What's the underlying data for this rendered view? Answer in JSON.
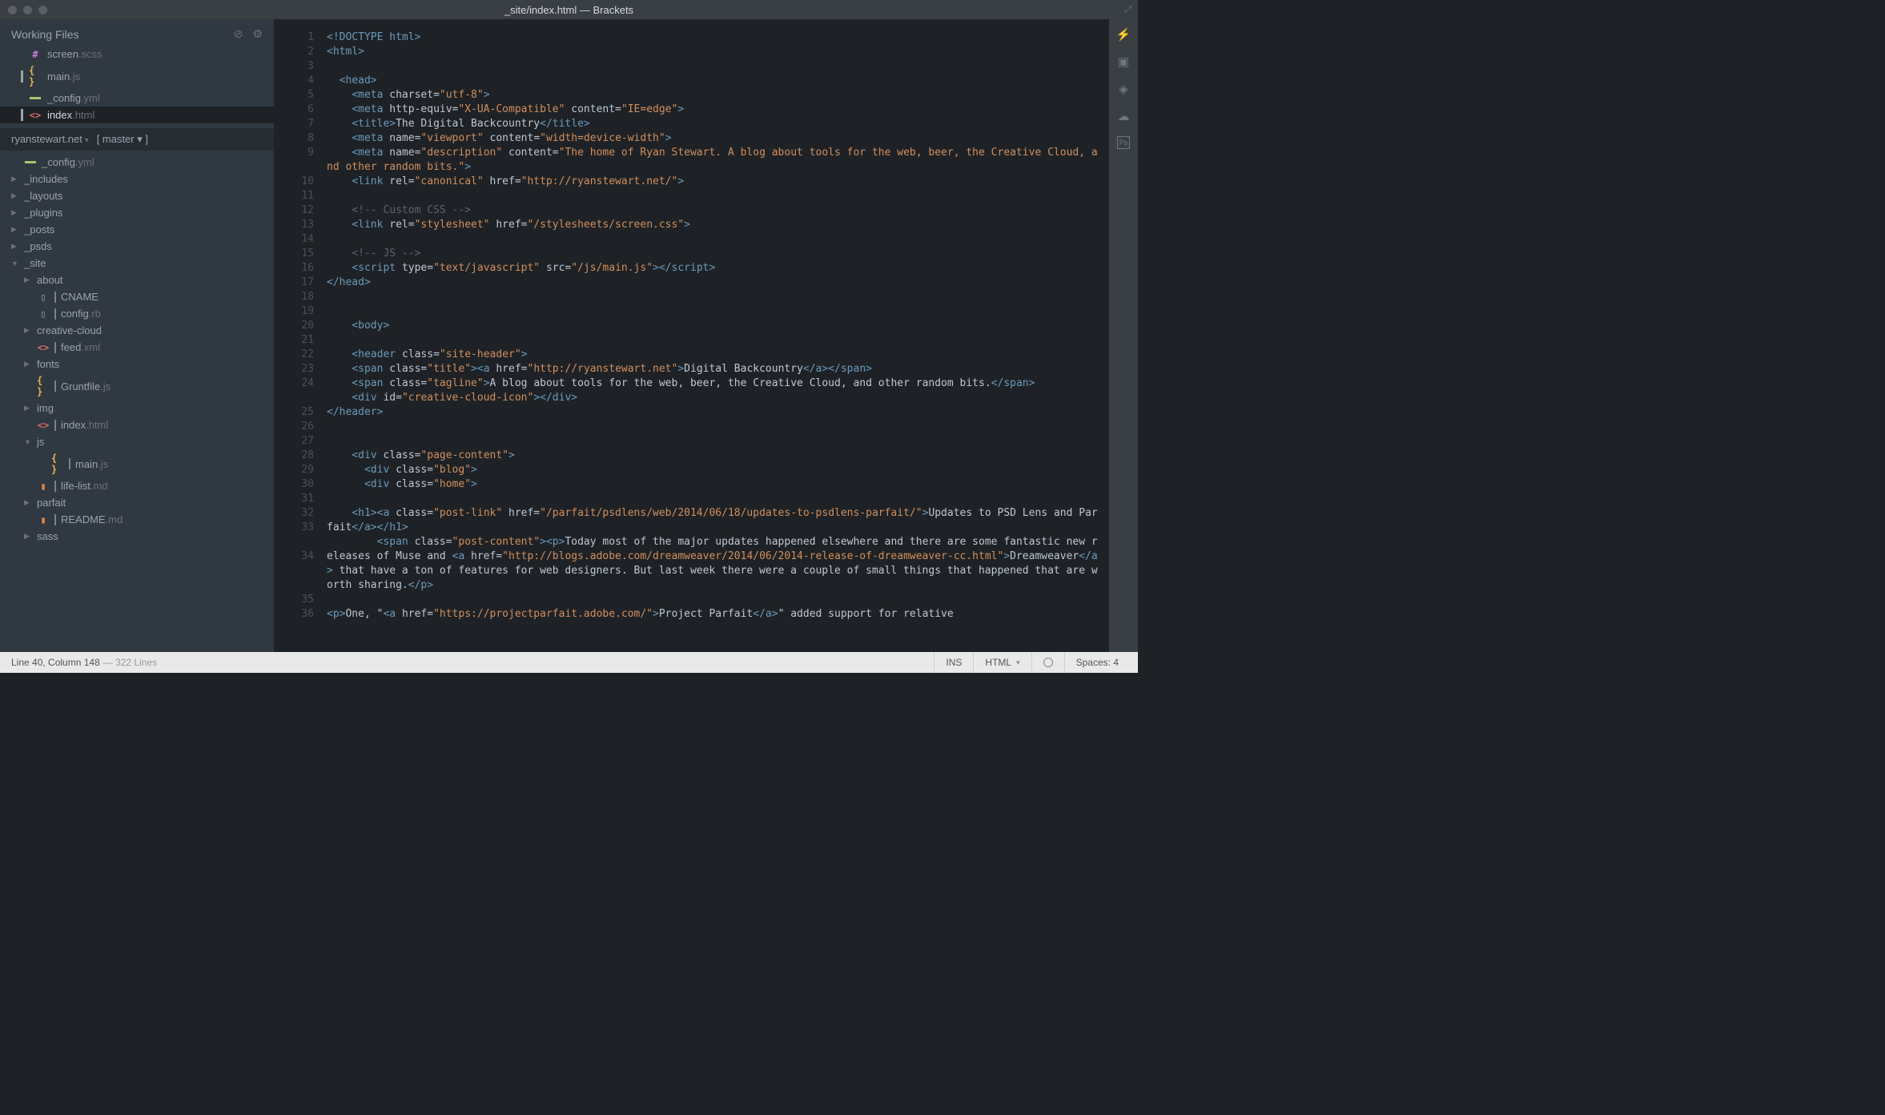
{
  "window": {
    "title": "_site/index.html — Brackets"
  },
  "sidebar": {
    "workingFilesTitle": "Working Files",
    "workingFiles": [
      {
        "name": "screen",
        "ext": ".scss",
        "icon": "hash",
        "dirty": false
      },
      {
        "name": "main",
        "ext": ".js",
        "icon": "js",
        "dirty": true
      },
      {
        "name": "_config",
        "ext": ".yml",
        "icon": "yml",
        "dirty": false
      },
      {
        "name": "index",
        "ext": ".html",
        "icon": "html",
        "dirty": true,
        "active": true
      }
    ],
    "projectName": "ryanstewart.net",
    "branch": "[ master ▾ ]",
    "tree": [
      {
        "depth": 1,
        "kind": "file",
        "name": "_config",
        "ext": ".yml",
        "icon": "yml"
      },
      {
        "depth": 1,
        "kind": "folder",
        "name": "_includes",
        "open": false
      },
      {
        "depth": 1,
        "kind": "folder",
        "name": "_layouts",
        "open": false
      },
      {
        "depth": 1,
        "kind": "folder",
        "name": "_plugins",
        "open": false
      },
      {
        "depth": 1,
        "kind": "folder",
        "name": "_posts",
        "open": false
      },
      {
        "depth": 1,
        "kind": "folder",
        "name": "_psds",
        "open": false
      },
      {
        "depth": 1,
        "kind": "folder",
        "name": "_site",
        "open": true
      },
      {
        "depth": 2,
        "kind": "folder",
        "name": "about",
        "open": false
      },
      {
        "depth": 2,
        "kind": "file",
        "name": "CNAME",
        "ext": "",
        "icon": "empty",
        "bar": true
      },
      {
        "depth": 2,
        "kind": "file",
        "name": "config",
        "ext": ".rb",
        "icon": "empty",
        "bar": true
      },
      {
        "depth": 2,
        "kind": "folder",
        "name": "creative-cloud",
        "open": false
      },
      {
        "depth": 2,
        "kind": "file",
        "name": "feed",
        "ext": ".xml",
        "icon": "html",
        "bar": true
      },
      {
        "depth": 2,
        "kind": "folder",
        "name": "fonts",
        "open": false
      },
      {
        "depth": 2,
        "kind": "file",
        "name": "Gruntfile",
        "ext": ".js",
        "icon": "js",
        "bar": true
      },
      {
        "depth": 2,
        "kind": "folder",
        "name": "img",
        "open": false
      },
      {
        "depth": 2,
        "kind": "file",
        "name": "index",
        "ext": ".html",
        "icon": "html",
        "bar": true
      },
      {
        "depth": 2,
        "kind": "folder",
        "name": "js",
        "open": true
      },
      {
        "depth": 3,
        "kind": "file",
        "name": "main",
        "ext": ".js",
        "icon": "js",
        "bar": true
      },
      {
        "depth": 2,
        "kind": "file",
        "name": "life-list",
        "ext": ".md",
        "icon": "md",
        "bar": true
      },
      {
        "depth": 2,
        "kind": "folder",
        "name": "parfait",
        "open": false
      },
      {
        "depth": 2,
        "kind": "file",
        "name": "README",
        "ext": ".md",
        "icon": "md",
        "bar": true
      },
      {
        "depth": 2,
        "kind": "folder",
        "name": "sass",
        "open": false
      }
    ]
  },
  "editor": {
    "lineCount": 36,
    "wrapLines": {
      "9": 2,
      "24": 2,
      "33": 2,
      "34": 3
    }
  },
  "status": {
    "cursor": "Line 40, Column 148",
    "lines": " — 322 Lines",
    "ins": "INS",
    "lang": "HTML",
    "spaces": "Spaces: 4"
  },
  "code": {
    "l1": [
      [
        "tag",
        "<!DOCTYPE html>"
      ]
    ],
    "l2": [
      [
        "tag",
        "<html>"
      ]
    ],
    "l3": [
      [
        "txt",
        ""
      ]
    ],
    "l4": [
      [
        "tag",
        "  <head>"
      ]
    ],
    "l5": [
      [
        "tag",
        "    <meta "
      ],
      [
        "attr",
        "charset="
      ],
      [
        "str",
        "\"utf-8\""
      ],
      [
        "tag",
        ">"
      ]
    ],
    "l6": [
      [
        "tag",
        "    <meta "
      ],
      [
        "attr",
        "http-equiv="
      ],
      [
        "str",
        "\"X-UA-Compatible\""
      ],
      [
        "attr",
        " content="
      ],
      [
        "str",
        "\"IE=edge\""
      ],
      [
        "tag",
        ">"
      ]
    ],
    "l7": [
      [
        "tag",
        "    <title>"
      ],
      [
        "txt",
        "The Digital Backcountry"
      ],
      [
        "tag",
        "</title>"
      ]
    ],
    "l8": [
      [
        "tag",
        "    <meta "
      ],
      [
        "attr",
        "name="
      ],
      [
        "str",
        "\"viewport\""
      ],
      [
        "attr",
        " content="
      ],
      [
        "str",
        "\"width=device-width\""
      ],
      [
        "tag",
        ">"
      ]
    ],
    "l9": [
      [
        "tag",
        "    <meta "
      ],
      [
        "attr",
        "name="
      ],
      [
        "str",
        "\"description\""
      ],
      [
        "attr",
        " content="
      ],
      [
        "str",
        "\"The home of Ryan Stewart. A blog about tools for the web, beer, the Creative Cloud, and other random bits.\""
      ],
      [
        "tag",
        ">"
      ]
    ],
    "l10": [
      [
        "tag",
        "    <link "
      ],
      [
        "attr",
        "rel="
      ],
      [
        "str",
        "\"canonical\""
      ],
      [
        "attr",
        " href="
      ],
      [
        "str",
        "\"http://ryanstewart.net/\""
      ],
      [
        "tag",
        ">"
      ]
    ],
    "l11": [
      [
        "txt",
        ""
      ]
    ],
    "l12": [
      [
        "com",
        "    <!-- Custom CSS -->"
      ]
    ],
    "l13": [
      [
        "tag",
        "    <link "
      ],
      [
        "attr",
        "rel="
      ],
      [
        "str",
        "\"stylesheet\""
      ],
      [
        "attr",
        " href="
      ],
      [
        "str",
        "\"/stylesheets/screen.css\""
      ],
      [
        "tag",
        ">"
      ]
    ],
    "l14": [
      [
        "txt",
        ""
      ]
    ],
    "l15": [
      [
        "com",
        "    <!-- JS -->"
      ]
    ],
    "l16": [
      [
        "tag",
        "    <script "
      ],
      [
        "attr",
        "type="
      ],
      [
        "str",
        "\"text/javascript\""
      ],
      [
        "attr",
        " src="
      ],
      [
        "str",
        "\"/js/main.js\""
      ],
      [
        "tag",
        "></script>"
      ]
    ],
    "l17": [
      [
        "tag",
        "</head>"
      ]
    ],
    "l18": [
      [
        "txt",
        ""
      ]
    ],
    "l19": [
      [
        "txt",
        ""
      ]
    ],
    "l20": [
      [
        "tag",
        "    <body>"
      ]
    ],
    "l21": [
      [
        "txt",
        ""
      ]
    ],
    "l22": [
      [
        "tag",
        "    <header "
      ],
      [
        "attr",
        "class="
      ],
      [
        "str",
        "\"site-header\""
      ],
      [
        "tag",
        ">"
      ]
    ],
    "l23": [
      [
        "tag",
        "    <span "
      ],
      [
        "attr",
        "class="
      ],
      [
        "str",
        "\"title\""
      ],
      [
        "tag",
        "><a "
      ],
      [
        "attr",
        "href="
      ],
      [
        "str",
        "\"http://ryanstewart.net\""
      ],
      [
        "tag",
        ">"
      ],
      [
        "txt",
        "Digital Backcountry"
      ],
      [
        "tag",
        "</a></span>"
      ]
    ],
    "l24": [
      [
        "tag",
        "    <span "
      ],
      [
        "attr",
        "class="
      ],
      [
        "str",
        "\"tagline\""
      ],
      [
        "tag",
        ">"
      ],
      [
        "txt",
        "A blog about tools for the web, beer, the Creative Cloud, and other random bits."
      ],
      [
        "tag",
        "</span>"
      ]
    ],
    "l25": [
      [
        "tag",
        "    <div "
      ],
      [
        "attr",
        "id="
      ],
      [
        "str",
        "\"creative-cloud-icon\""
      ],
      [
        "tag",
        "></div>"
      ]
    ],
    "l26": [
      [
        "tag",
        "</header>"
      ]
    ],
    "l27": [
      [
        "txt",
        ""
      ]
    ],
    "l28": [
      [
        "txt",
        ""
      ]
    ],
    "l29": [
      [
        "tag",
        "    <div "
      ],
      [
        "attr",
        "class="
      ],
      [
        "str",
        "\"page-content\""
      ],
      [
        "tag",
        ">"
      ]
    ],
    "l30": [
      [
        "tag",
        "      <div "
      ],
      [
        "attr",
        "class="
      ],
      [
        "str",
        "\"blog\""
      ],
      [
        "tag",
        ">"
      ]
    ],
    "l31": [
      [
        "tag",
        "      <div "
      ],
      [
        "attr",
        "class="
      ],
      [
        "str",
        "\"home\""
      ],
      [
        "tag",
        ">"
      ]
    ],
    "l32": [
      [
        "txt",
        ""
      ]
    ],
    "l33": [
      [
        "tag",
        "    <h1><a "
      ],
      [
        "attr",
        "class="
      ],
      [
        "str",
        "\"post-link\""
      ],
      [
        "attr",
        " href="
      ],
      [
        "str",
        "\"/parfait/psdlens/web/2014/06/18/updates-to-psdlens-parfait/\""
      ],
      [
        "tag",
        ">"
      ],
      [
        "txt",
        "Updates to PSD Lens and Parfait"
      ],
      [
        "tag",
        "</a></h1>"
      ]
    ],
    "l34": [
      [
        "tag",
        "        <span "
      ],
      [
        "attr",
        "class="
      ],
      [
        "str",
        "\"post-content\""
      ],
      [
        "tag",
        "><p>"
      ],
      [
        "txt",
        "Today most of the major updates happened elsewhere and there are some fantastic new releases of Muse and "
      ],
      [
        "tag",
        "<a "
      ],
      [
        "attr",
        "href="
      ],
      [
        "str",
        "\"http://blogs.adobe.com/dreamweaver/2014/06/2014-release-of-dreamweaver-cc.html\""
      ],
      [
        "tag",
        ">"
      ],
      [
        "txt",
        "Dreamweaver"
      ],
      [
        "tag",
        "</a>"
      ],
      [
        "txt",
        " that have a ton of features for web designers. But last week there were a couple of small things that happened that are worth sharing."
      ],
      [
        "tag",
        "</p>"
      ]
    ],
    "l35": [
      [
        "txt",
        ""
      ]
    ],
    "l36": [
      [
        "tag",
        "<p>"
      ],
      [
        "txt",
        "One, \""
      ],
      [
        "tag",
        "<a "
      ],
      [
        "attr",
        "href="
      ],
      [
        "str",
        "\"https://projectparfait.adobe.com/\""
      ],
      [
        "tag",
        ">"
      ],
      [
        "txt",
        "Project Parfait"
      ],
      [
        "tag",
        "</a>"
      ],
      [
        "txt",
        "\" added support for relative"
      ]
    ]
  }
}
